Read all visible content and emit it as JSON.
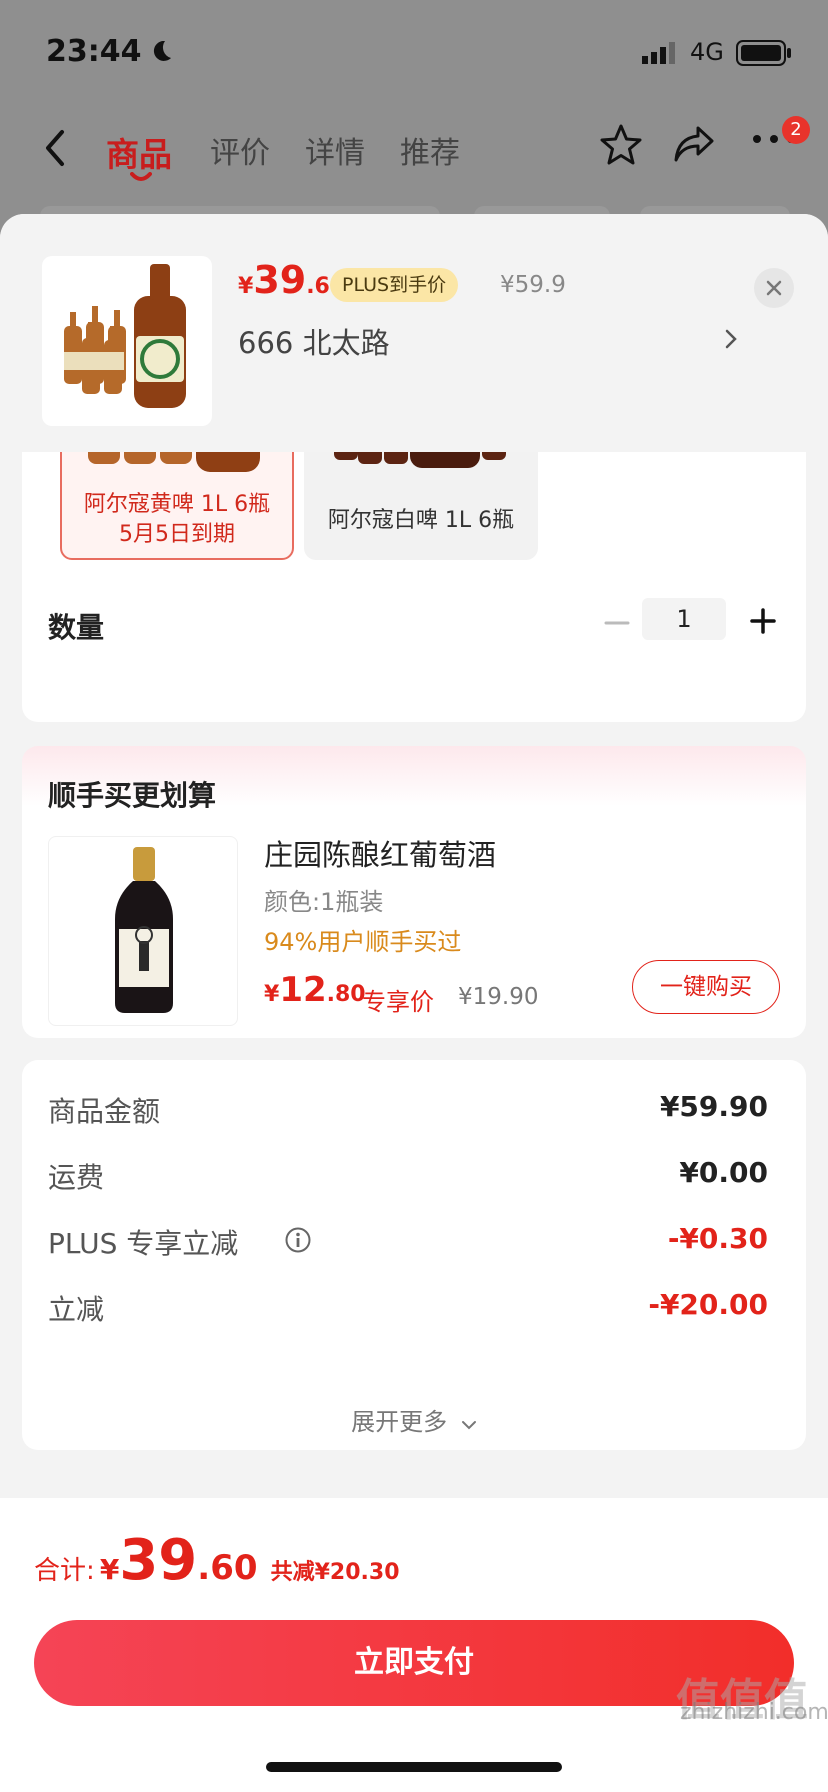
{
  "status": {
    "time": "23:44",
    "network": "4G"
  },
  "nav": {
    "tabs": [
      {
        "label": "商品",
        "active": true
      },
      {
        "label": "评价",
        "active": false
      },
      {
        "label": "详情",
        "active": false
      },
      {
        "label": "推荐",
        "active": false
      }
    ],
    "badge": "2"
  },
  "header": {
    "price_yen": "¥",
    "price_int": "39",
    "price_dec": ".6",
    "plus_tag": "PLUS到手价",
    "original_price": "¥59.9",
    "address": "666  北太路"
  },
  "variants": [
    {
      "label_line1": "阿尔寇黄啤 1L 6瓶",
      "label_line2": "5月5日到期",
      "selected": true
    },
    {
      "label_line1": "阿尔寇白啤 1L 6瓶",
      "selected": false
    }
  ],
  "quantity": {
    "label": "数量",
    "value": "1"
  },
  "addon": {
    "title": "顺手买更划算",
    "name": "庄园陈酿红葡萄酒",
    "spec": "颜色:1瓶装",
    "rate": "94%用户顺手买过",
    "price_yen": "¥",
    "price_int": "12",
    "price_dec": ".80",
    "exclusive": "专享价",
    "original_price": "¥19.90",
    "buy_label": "一键购买"
  },
  "summary": {
    "rows": [
      {
        "label": "商品金额",
        "value": "¥59.90",
        "color": "#222222"
      },
      {
        "label": "运费",
        "value": "¥0.00",
        "color": "#222222"
      },
      {
        "label": "PLUS 专享立减",
        "value": "-¥0.30",
        "color": "#e2231a"
      },
      {
        "label": "立减",
        "value": "-¥20.00",
        "color": "#e2231a"
      }
    ],
    "expand_label": "展开更多"
  },
  "footer": {
    "total_label": "合计:",
    "total_yen": "¥",
    "total_int": "39",
    "total_dec": ".60",
    "saved": "共减¥20.30",
    "pay_label": "立即支付"
  },
  "watermark": {
    "big": "值值值",
    "small": "zhizhizhi.com"
  },
  "colors": {
    "accent": "#e2231a",
    "plus_tag_bg": "#fbe6a6"
  }
}
